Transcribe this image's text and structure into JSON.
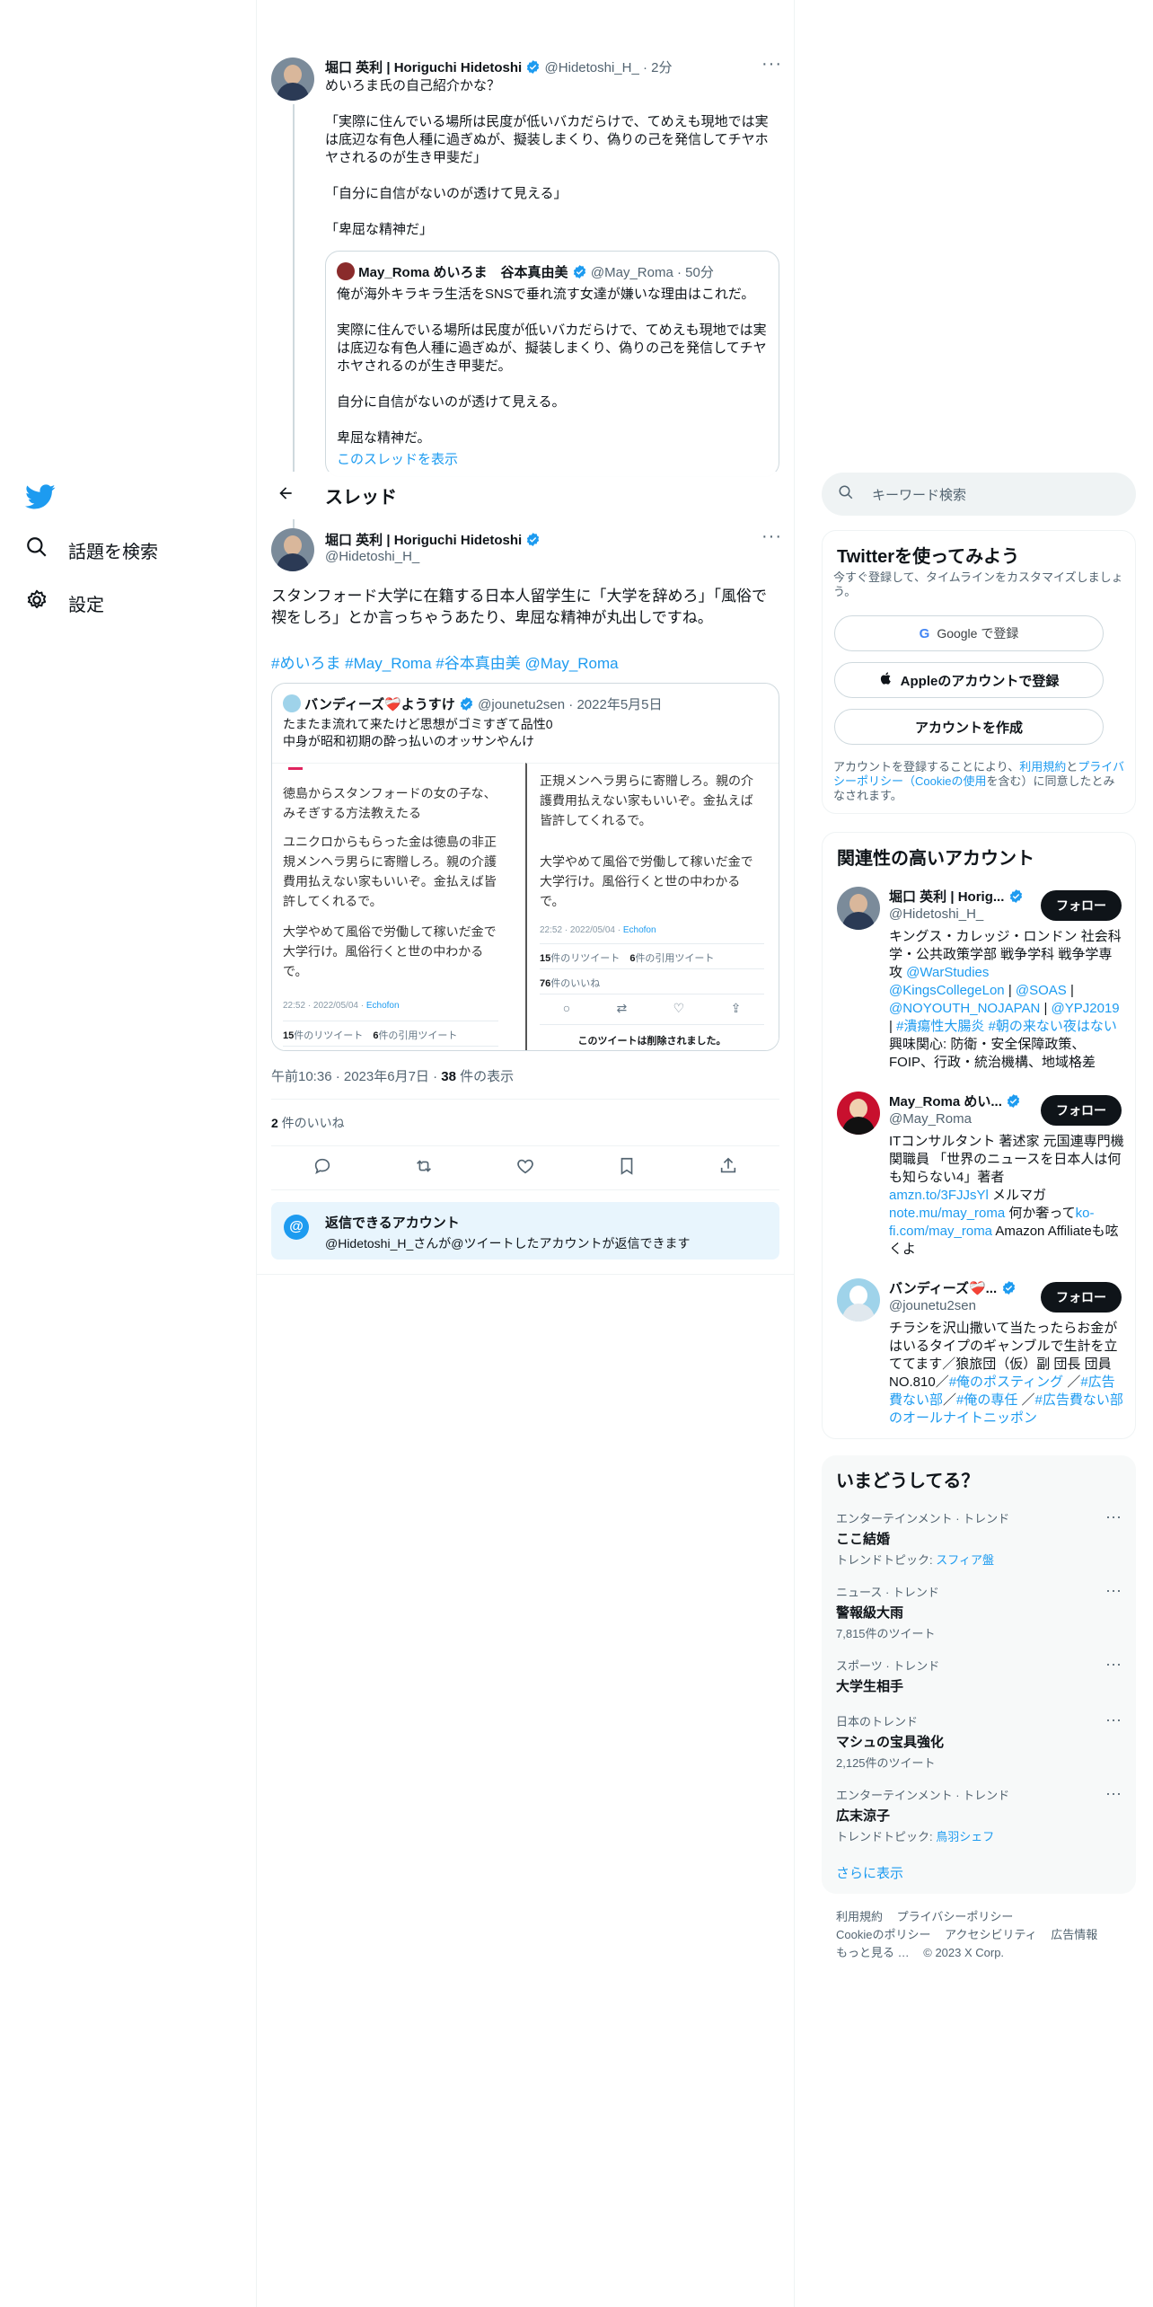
{
  "nav": {
    "items": [
      {
        "label": "話題を検索",
        "icon": "search-icon"
      },
      {
        "label": "設定",
        "icon": "gear-icon"
      }
    ]
  },
  "header": {
    "title": "スレッド"
  },
  "parent_tweet": {
    "name": "堀口 英利 | Horiguchi Hidetoshi",
    "handle": "@Hidetoshi_H_",
    "time": "2分",
    "text": "めいろま氏の自己紹介かな？\n\n「実際に住んでいる場所は民度が低いバカだらけで、てめえも現地では実は底辺な有色人種に過ぎぬが、擬装しまくり、偽りの己を発信してチヤホヤされるのが生き甲斐だ」\n\n「自分に自信がないのが透けて見える」\n\n「卑屈な精神だ」",
    "quote": {
      "name": "May_Roma めいろま　谷本真由美",
      "handle": "@May_Roma",
      "time": "50分",
      "text": "俺が海外キラキラ生活をSNSで垂れ流す女達が嫌いな理由はこれだ。\n\n実際に住んでいる場所は民度が低いバカだらけで、てめえも現地では実は底辺な有色人種に過ぎぬが、擬装しまくり、偽りの己を発信してチヤホヤされるのが生き甲斐だ。\n\n自分に自信がないのが透けて見える。\n\n卑屈な精神だ。",
      "show_thread": "このスレッドを表示"
    }
  },
  "main_tweet": {
    "name": "堀口 英利 | Horiguchi Hidetoshi",
    "handle": "@Hidetoshi_H_",
    "text": "スタンフォード大学に在籍する日本人留学生に「大学を辞めろ」「風俗で禊をしろ」とか言っちゃうあたり、卑屈な精神が丸出しですね。",
    "hashtags": "#めいろま #May_Roma #谷本真由美 @May_Roma",
    "quote": {
      "name": "バンディーズ❤️‍🩹ようすけ",
      "handle": "@jounetu2sen",
      "time": "2022年5月5日",
      "text": "たまたま流れて来たけど思想がゴミすぎて品性0\n中身が昭和初期の酔っ払いのオッサンやんけ",
      "img_left": {
        "p1": "徳島からスタンフォードの女の子な、みそぎする方法教えたる",
        "p2": "ユニクロからもらった金は徳島の非正規メンヘラ男らに寄贈しろ。親の介護費用払えない家もいいぞ。金払えば皆許してくれるで。",
        "p3": "大学やめて風俗で労働して稼いだ金で大学行け。風俗行くと世の中わかるで。",
        "time": "22:52 · 2022/05/04 ·",
        "via": "Echofon",
        "rt": "15",
        "rt_label": "件のリツイート",
        "qt": "6",
        "qt_label": "件の引用ツイート"
      },
      "img_right": {
        "p1": "正規メンヘラ男らに寄贈しろ。親の介護費用払えない家もいいぞ。金払えば皆許してくれるで。",
        "p2": "大学やめて風俗で労働して稼いだ金で大学行け。風俗行くと世の中わかるで。",
        "time": "22:52 · 2022/05/04 ·",
        "via": "Echofon",
        "rt": "15",
        "rt_label": "件のリツイート",
        "qt": "6",
        "qt_label": "件の引用ツイート",
        "likes": "76",
        "likes_label": "件のいいね",
        "deleted": "このツイートは削除されました。"
      }
    },
    "timestamp": "午前10:36 · 2023年6月7日 · ",
    "views": "38",
    "views_label": " 件の表示",
    "likes": "2",
    "likes_label": " 件のいいね",
    "reply_box": {
      "title": "返信できるアカウント",
      "text": "@Hidetoshi_H_さんが@ツイートしたアカウントが返信できます"
    }
  },
  "search": {
    "placeholder": "キーワード検索"
  },
  "signup": {
    "title": "Twitterを使ってみよう",
    "subtitle": "今すぐ登録して、タイムラインをカスタマイズしましょう。",
    "google": "Google で登録",
    "apple": "Appleのアカウントで登録",
    "create": "アカウントを作成",
    "legal_1": "アカウントを登録することにより、",
    "legal_terms": "利用規約",
    "legal_2": "と",
    "legal_privacy": "プライバシーポリシー",
    "legal_cookie": "（Cookieの使用",
    "legal_3": "を含む）に同意したとみなされます。"
  },
  "related": {
    "title": "関連性の高いアカウント",
    "follow_label": "フォロー",
    "accounts": [
      {
        "name": "堀口 英利 | Horig...",
        "handle": "@Hidetoshi_H_",
        "bio_1": "キングス・カレッジ・ロンドン 社会科学・公共政策学部 戦争学科 戦争学専攻 ",
        "bio_link_1": "@WarStudies",
        "bio_link_2": "@KingsCollegeLon",
        "bio_sep_1": " | ",
        "bio_link_3": "@SOAS",
        "bio_sep_2": " | ",
        "bio_link_4": "@NOYOUTH_NOJAPAN",
        "bio_sep_3": " | ",
        "bio_link_5": "@YPJ2019",
        "bio_sep_4": " | ",
        "bio_link_6": "#潰瘍性大腸炎",
        "bio_link_7": "#朝の来ない夜はない",
        "bio_2": "興味関心: 防衛・安全保障政策、FOIP、行政・統治機構、地域格差"
      },
      {
        "name": "May_Roma めい...",
        "handle": "@May_Roma",
        "bio_1": "ITコンサルタント 著述家 元国連専門機関職員 「世界のニュースを日本人は何も知らない4」著者",
        "bio_link_1": "amzn.to/3FJJsYl",
        "bio_2": " メルマガ ",
        "bio_link_2": "note.mu/may_roma",
        "bio_3": " 何か奢って",
        "bio_link_3": "ko-fi.com/may_roma",
        "bio_4": " Amazon Affiliateも呟くよ"
      },
      {
        "name": "バンディーズ❤️‍🩹...",
        "handle": "@jounetu2sen",
        "bio_1": "チラシを沢山撒いて当たったらお金がはいるタイプのギャンブルで生計を立ててます／狼旅団（仮）副 団長 団員NO.810／",
        "bio_link_1": "#俺のポスティング",
        "bio_2": " ／",
        "bio_link_2": "#広告費ない部",
        "bio_3": "／",
        "bio_link_3": "#俺の専任",
        "bio_4": " ／",
        "bio_link_4": "#広告費ない部のオールナイトニッポン"
      }
    ]
  },
  "trends": {
    "title": "いまどうしてる？",
    "items": [
      {
        "category": "エンターテインメント · トレンド",
        "name": "ここ結婚",
        "meta_prefix": "トレンドトピック: ",
        "meta_link": "スフィア盤"
      },
      {
        "category": "ニュース · トレンド",
        "name": "警報級大雨",
        "meta": "7,815件のツイート"
      },
      {
        "category": "スポーツ · トレンド",
        "name": "大学生相手"
      },
      {
        "category": "日本のトレンド",
        "name": "マシュの宝具強化",
        "meta": "2,125件のツイート"
      },
      {
        "category": "エンターテインメント · トレンド",
        "name": "広末涼子",
        "meta_prefix": "トレンドトピック: ",
        "meta_link": "鳥羽シェフ"
      }
    ],
    "show_more": "さらに表示"
  },
  "footer": {
    "links": [
      "利用規約",
      "プライバシーポリシー",
      "Cookieのポリシー",
      "アクセシビリティ",
      "広告情報",
      "もっと見る …"
    ],
    "copyright": "© 2023 X Corp."
  },
  "colors": {
    "accent": "#1d9bf0",
    "text": "#0f1419",
    "muted": "#536471",
    "border": "#cfd9de"
  }
}
